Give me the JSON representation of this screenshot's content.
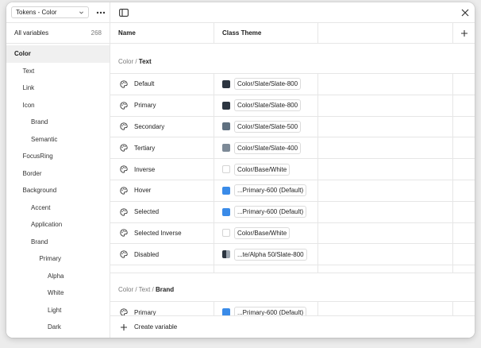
{
  "sidebar": {
    "collection": "Tokens - Color",
    "all_variables_label": "All variables",
    "all_variables_count": "268",
    "tree": [
      {
        "label": "Color",
        "indent": 0,
        "selected": true
      },
      {
        "label": "Text",
        "indent": 1
      },
      {
        "label": "Link",
        "indent": 1
      },
      {
        "label": "Icon",
        "indent": 1
      },
      {
        "label": "Brand",
        "indent": 2
      },
      {
        "label": "Semantic",
        "indent": 2
      },
      {
        "label": "FocusRing",
        "indent": 1
      },
      {
        "label": "Border",
        "indent": 1
      },
      {
        "label": "Background",
        "indent": 1
      },
      {
        "label": "Accent",
        "indent": 2
      },
      {
        "label": "Application",
        "indent": 2
      },
      {
        "label": "Brand",
        "indent": 2
      },
      {
        "label": "Primary",
        "indent": 3
      },
      {
        "label": "Alpha",
        "indent": 4
      },
      {
        "label": "White",
        "indent": 4
      },
      {
        "label": "Light",
        "indent": 4
      },
      {
        "label": "Dark",
        "indent": 4
      }
    ]
  },
  "table": {
    "columns": {
      "name": "Name",
      "theme": "Class Theme"
    },
    "groups": [
      {
        "path": "Color / ",
        "title": "Text",
        "rows": [
          {
            "name": "Default",
            "value": "Color/Slate/Slate-800",
            "swatch": "#2c3540",
            "kind": "solid"
          },
          {
            "name": "Primary",
            "value": "Color/Slate/Slate-800",
            "swatch": "#2c3540",
            "kind": "solid"
          },
          {
            "name": "Secondary",
            "value": "Color/Slate/Slate-500",
            "swatch": "#5f7080",
            "kind": "solid"
          },
          {
            "name": "Tertiary",
            "value": "Color/Slate/Slate-400",
            "swatch": "#7d8a97",
            "kind": "solid"
          },
          {
            "name": "Inverse",
            "value": "Color/Base/White",
            "swatch": "#ffffff",
            "kind": "white"
          },
          {
            "name": "Hover",
            "value": "...Primary-600 (Default)",
            "swatch": "#3a8be8",
            "kind": "solid"
          },
          {
            "name": "Selected",
            "value": "...Primary-600 (Default)",
            "swatch": "#3a8be8",
            "kind": "solid"
          },
          {
            "name": "Selected Inverse",
            "value": "Color/Base/White",
            "swatch": "#ffffff",
            "kind": "white"
          },
          {
            "name": "Disabled",
            "value": "...te/Alpha 50/Slate-800",
            "swatch": "#2c3540",
            "kind": "alpha"
          }
        ]
      },
      {
        "path": "Color / Text / ",
        "title": "Brand",
        "rows": [
          {
            "name": "Primary",
            "value": "...Primary-600 (Default)",
            "swatch": "#3a8be8",
            "kind": "solid"
          }
        ]
      }
    ]
  },
  "footer": {
    "create_label": "Create variable"
  },
  "icons": {
    "more": "more-icon",
    "sidebar_toggle": "sidebar-toggle-icon",
    "close": "close-icon",
    "add_column": "plus-icon",
    "variable": "palette-icon"
  }
}
